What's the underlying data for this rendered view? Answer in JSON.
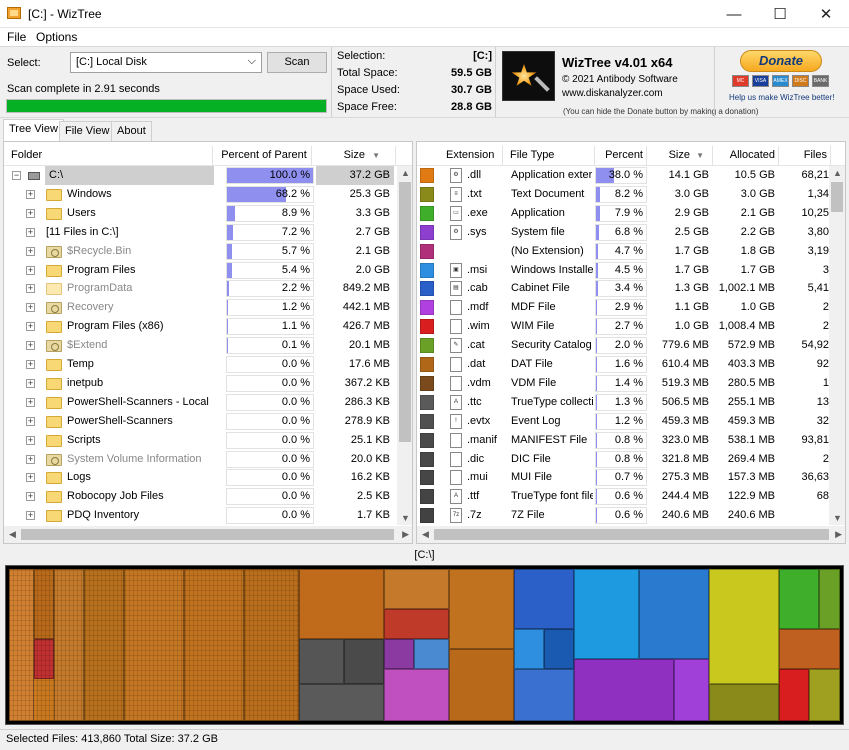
{
  "window": {
    "title": "[C:]  - WizTree",
    "minimize": "—",
    "maximize": "☐",
    "close": "✕"
  },
  "menu": [
    "File",
    "Options"
  ],
  "scan": {
    "select_label": "Select:",
    "drive": "[C:] Local Disk",
    "scan_label": "Scan",
    "status": "Scan complete in 2.91 seconds",
    "progress_fraction": 1.0
  },
  "info": [
    {
      "label": "Selection:",
      "value": "[C:]"
    },
    {
      "label": "Total Space:",
      "value": "59.5 GB"
    },
    {
      "label": "Space Used:",
      "value": "30.7 GB"
    },
    {
      "label": "Space Free:",
      "value": "28.8 GB"
    }
  ],
  "brand": {
    "title": "WizTree v4.01 x64",
    "copyright": "© 2021 Antibody Software",
    "url": "www.diskanalyzer.com",
    "note": "(You can hide the Donate button by making a donation)"
  },
  "donate": {
    "label": "Donate",
    "note": "Help us make WizTree better!",
    "cards": [
      "MC",
      "VISA",
      "AMEX",
      "DISC",
      "BANK"
    ]
  },
  "tabs": [
    {
      "label": "Tree View",
      "active": true
    },
    {
      "label": "File View",
      "active": false
    },
    {
      "label": "About",
      "active": false
    }
  ],
  "tree": {
    "headers": {
      "folder": "Folder",
      "percent": "Percent of Parent",
      "size": "Size"
    },
    "rows": [
      {
        "name": "C:\\",
        "percent": "100.0 %",
        "pct": 100,
        "size": "37.2 GB",
        "icon": "drive",
        "expander": "−",
        "indent": 0,
        "gray": false,
        "selected": true
      },
      {
        "name": "Windows",
        "percent": "68.2 %",
        "pct": 68.2,
        "size": "25.3 GB",
        "icon": "folder",
        "expander": "+",
        "indent": 1,
        "gray": false
      },
      {
        "name": "Users",
        "percent": "8.9 %",
        "pct": 8.9,
        "size": "3.3 GB",
        "icon": "folder",
        "expander": "+",
        "indent": 1,
        "gray": false
      },
      {
        "name": "[11 Files in C:\\]",
        "percent": "7.2 %",
        "pct": 7.2,
        "size": "2.7 GB",
        "icon": "none",
        "expander": "+",
        "indent": 1,
        "gray": false
      },
      {
        "name": "$Recycle.Bin",
        "percent": "5.7 %",
        "pct": 5.7,
        "size": "2.1 GB",
        "icon": "sys",
        "expander": "+",
        "indent": 1,
        "gray": true
      },
      {
        "name": "Program Files",
        "percent": "5.4 %",
        "pct": 5.4,
        "size": "2.0 GB",
        "icon": "folder",
        "expander": "+",
        "indent": 1,
        "gray": false
      },
      {
        "name": "ProgramData",
        "percent": "2.2 %",
        "pct": 2.2,
        "size": "849.2 MB",
        "icon": "light",
        "expander": "+",
        "indent": 1,
        "gray": true
      },
      {
        "name": "Recovery",
        "percent": "1.2 %",
        "pct": 1.2,
        "size": "442.1 MB",
        "icon": "sys",
        "expander": "+",
        "indent": 1,
        "gray": true
      },
      {
        "name": "Program Files (x86)",
        "percent": "1.1 %",
        "pct": 1.1,
        "size": "426.7 MB",
        "icon": "folder",
        "expander": "+",
        "indent": 1,
        "gray": false
      },
      {
        "name": "$Extend",
        "percent": "0.1 %",
        "pct": 0.1,
        "size": "20.1 MB",
        "icon": "sys",
        "expander": "+",
        "indent": 1,
        "gray": true
      },
      {
        "name": "Temp",
        "percent": "0.0 %",
        "pct": 0,
        "size": "17.6 MB",
        "icon": "folder",
        "expander": "+",
        "indent": 1,
        "gray": false
      },
      {
        "name": "inetpub",
        "percent": "0.0 %",
        "pct": 0,
        "size": "367.2 KB",
        "icon": "folder",
        "expander": "+",
        "indent": 1,
        "gray": false
      },
      {
        "name": "PowerShell-Scanners - Local",
        "percent": "0.0 %",
        "pct": 0,
        "size": "286.3 KB",
        "icon": "folder",
        "expander": "+",
        "indent": 1,
        "gray": false
      },
      {
        "name": "PowerShell-Scanners",
        "percent": "0.0 %",
        "pct": 0,
        "size": "278.9 KB",
        "icon": "folder",
        "expander": "+",
        "indent": 1,
        "gray": false
      },
      {
        "name": "Scripts",
        "percent": "0.0 %",
        "pct": 0,
        "size": "25.1 KB",
        "icon": "folder",
        "expander": "+",
        "indent": 1,
        "gray": false
      },
      {
        "name": "System Volume Information",
        "percent": "0.0 %",
        "pct": 0,
        "size": "20.0 KB",
        "icon": "sys",
        "expander": "+",
        "indent": 1,
        "gray": true
      },
      {
        "name": "Logs",
        "percent": "0.0 %",
        "pct": 0,
        "size": "16.2 KB",
        "icon": "folder",
        "expander": "+",
        "indent": 1,
        "gray": false
      },
      {
        "name": "Robocopy Job Files",
        "percent": "0.0 %",
        "pct": 0,
        "size": "2.5 KB",
        "icon": "folder",
        "expander": "+",
        "indent": 1,
        "gray": false
      },
      {
        "name": "PDQ Inventory",
        "percent": "0.0 %",
        "pct": 0,
        "size": "1.7 KB",
        "icon": "folder",
        "expander": "+",
        "indent": 1,
        "gray": false
      }
    ]
  },
  "types": {
    "headers": {
      "ext": "Extension",
      "type": "File Type",
      "percent": "Percent",
      "size": "Size",
      "allocated": "Allocated",
      "files": "Files"
    },
    "rows": [
      {
        "color": "#e07b14",
        "ext": ".dll",
        "type": "Application exter",
        "percent": "38.0 %",
        "pct": 38,
        "size": "14.1 GB",
        "allocated": "10.5 GB",
        "files": "68,21"
      },
      {
        "color": "#8a8a1a",
        "ext": ".txt",
        "type": "Text Document",
        "percent": "8.2 %",
        "pct": 8.2,
        "size": "3.0 GB",
        "allocated": "3.0 GB",
        "files": "1,34"
      },
      {
        "color": "#3fae2a",
        "ext": ".exe",
        "type": "Application",
        "percent": "7.9 %",
        "pct": 7.9,
        "size": "2.9 GB",
        "allocated": "2.1 GB",
        "files": "10,25"
      },
      {
        "color": "#8f3fd0",
        "ext": ".sys",
        "type": "System file",
        "percent": "6.8 %",
        "pct": 6.8,
        "size": "2.5 GB",
        "allocated": "2.2 GB",
        "files": "3,80"
      },
      {
        "color": "#b0307a",
        "ext": "",
        "type": "(No Extension)",
        "percent": "4.7 %",
        "pct": 4.7,
        "size": "1.7 GB",
        "allocated": "1.8 GB",
        "files": "3,19"
      },
      {
        "color": "#2e8fe0",
        "ext": ".msi",
        "type": "Windows Installe",
        "percent": "4.5 %",
        "pct": 4.5,
        "size": "1.7 GB",
        "allocated": "1.7 GB",
        "files": "3"
      },
      {
        "color": "#2a5fc8",
        "ext": ".cab",
        "type": "Cabinet File",
        "percent": "3.4 %",
        "pct": 3.4,
        "size": "1.3 GB",
        "allocated": "1,002.1 MB",
        "files": "5,41"
      },
      {
        "color": "#b040e0",
        "ext": ".mdf",
        "type": "MDF File",
        "percent": "2.9 %",
        "pct": 2.9,
        "size": "1.1 GB",
        "allocated": "1.0 GB",
        "files": "2"
      },
      {
        "color": "#d81e1e",
        "ext": ".wim",
        "type": "WIM File",
        "percent": "2.7 %",
        "pct": 2.7,
        "size": "1.0 GB",
        "allocated": "1,008.4 MB",
        "files": "2"
      },
      {
        "color": "#6aa026",
        "ext": ".cat",
        "type": "Security Catalog",
        "percent": "2.0 %",
        "pct": 2.0,
        "size": "779.6 MB",
        "allocated": "572.9 MB",
        "files": "54,92"
      },
      {
        "color": "#b06818",
        "ext": ".dat",
        "type": "DAT File",
        "percent": "1.6 %",
        "pct": 1.6,
        "size": "610.4 MB",
        "allocated": "403.3 MB",
        "files": "92"
      },
      {
        "color": "#7a4a1c",
        "ext": ".vdm",
        "type": "VDM File",
        "percent": "1.4 %",
        "pct": 1.4,
        "size": "519.3 MB",
        "allocated": "280.5 MB",
        "files": "1"
      },
      {
        "color": "#5a5a5a",
        "ext": ".ttc",
        "type": "TrueType collecti",
        "percent": "1.3 %",
        "pct": 1.3,
        "size": "506.5 MB",
        "allocated": "255.1 MB",
        "files": "13"
      },
      {
        "color": "#505050",
        "ext": ".evtx",
        "type": "Event Log",
        "percent": "1.2 %",
        "pct": 1.2,
        "size": "459.3 MB",
        "allocated": "459.3 MB",
        "files": "32"
      },
      {
        "color": "#4a4a4a",
        "ext": ".manif",
        "type": "MANIFEST File",
        "percent": "0.8 %",
        "pct": 0.8,
        "size": "323.0 MB",
        "allocated": "538.1 MB",
        "files": "93,81"
      },
      {
        "color": "#484848",
        "ext": ".dic",
        "type": "DIC File",
        "percent": "0.8 %",
        "pct": 0.8,
        "size": "321.8 MB",
        "allocated": "269.4 MB",
        "files": "2"
      },
      {
        "color": "#464646",
        "ext": ".mui",
        "type": "MUI File",
        "percent": "0.7 %",
        "pct": 0.7,
        "size": "275.3 MB",
        "allocated": "157.3 MB",
        "files": "36,63"
      },
      {
        "color": "#444444",
        "ext": ".ttf",
        "type": "TrueType font file",
        "percent": "0.6 %",
        "pct": 0.6,
        "size": "244.4 MB",
        "allocated": "122.9 MB",
        "files": "68"
      },
      {
        "color": "#424242",
        "ext": ".7z",
        "type": "7Z File",
        "percent": "0.6 %",
        "pct": 0.6,
        "size": "240.6 MB",
        "allocated": "240.6 MB",
        "files": ""
      }
    ]
  },
  "path": "[C:\\]",
  "status": "Selected Files: 413,860  Total Size: 37.2 GB"
}
